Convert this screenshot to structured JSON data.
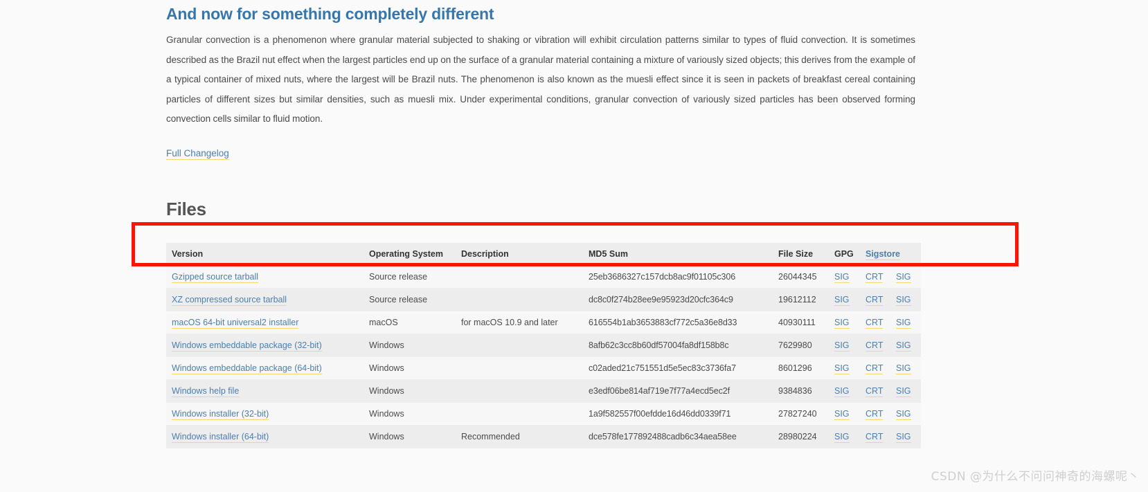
{
  "release": {
    "title": "And now for something completely different",
    "body": "Granular convection is a phenomenon where granular material subjected to shaking or vibration will exhibit circulation patterns similar to types of fluid convection. It is sometimes described as the Brazil nut effect when the largest particles end up on the surface of a granular material containing a mixture of variously sized objects; this derives from the example of a typical container of mixed nuts, where the largest will be Brazil nuts. The phenomenon is also known as the muesli effect since it is seen in packets of breakfast cereal containing particles of different sizes but similar densities, such as muesli mix. Under experimental conditions, granular convection of variously sized particles has been observed forming convection cells similar to fluid motion.",
    "changelog_label": "Full Changelog"
  },
  "files_section": {
    "heading": "Files",
    "columns": {
      "version": "Version",
      "os": "Operating System",
      "description": "Description",
      "md5": "MD5 Sum",
      "size": "File Size",
      "gpg": "GPG",
      "sigstore": "Sigstore"
    },
    "rows": [
      {
        "version": "Gzipped source tarball",
        "os": "Source release",
        "description": "",
        "md5": "25eb3686327c157dcb8ac9f01105c306",
        "size": "26044345",
        "gpg": "SIG",
        "sigstore_crt": "CRT",
        "sigstore_sig": "SIG"
      },
      {
        "version": "XZ compressed source tarball",
        "os": "Source release",
        "description": "",
        "md5": "dc8c0f274b28ee9e95923d20cfc364c9",
        "size": "19612112",
        "gpg": "SIG",
        "sigstore_crt": "CRT",
        "sigstore_sig": "SIG"
      },
      {
        "version": "macOS 64-bit universal2 installer",
        "os": "macOS",
        "description": "for macOS 10.9 and later",
        "md5": "616554b1ab3653883cf772c5a36e8d33",
        "size": "40930111",
        "gpg": "SIG",
        "sigstore_crt": "CRT",
        "sigstore_sig": "SIG"
      },
      {
        "version": "Windows embeddable package (32-bit)",
        "os": "Windows",
        "description": "",
        "md5": "8afb62c3cc8b60df57004fa8df158b8c",
        "size": "7629980",
        "gpg": "SIG",
        "sigstore_crt": "CRT",
        "sigstore_sig": "SIG"
      },
      {
        "version": "Windows embeddable package (64-bit)",
        "os": "Windows",
        "description": "",
        "md5": "c02aded21c751551d5e5ec83c3736fa7",
        "size": "8601296",
        "gpg": "SIG",
        "sigstore_crt": "CRT",
        "sigstore_sig": "SIG"
      },
      {
        "version": "Windows help file",
        "os": "Windows",
        "description": "",
        "md5": "e3edf06be814af719e7f77a4ecd5ec2f",
        "size": "9384836",
        "gpg": "SIG",
        "sigstore_crt": "CRT",
        "sigstore_sig": "SIG"
      },
      {
        "version": "Windows installer (32-bit)",
        "os": "Windows",
        "description": "",
        "md5": "1a9f582557f00efdde16d46dd0339f71",
        "size": "27827240",
        "gpg": "SIG",
        "sigstore_crt": "CRT",
        "sigstore_sig": "SIG"
      },
      {
        "version": "Windows installer (64-bit)",
        "os": "Windows",
        "description": "Recommended",
        "md5": "dce578fe177892488cadb6c34aea58ee",
        "size": "28980224",
        "gpg": "SIG",
        "sigstore_crt": "CRT",
        "sigstore_sig": "SIG"
      }
    ]
  },
  "annotation": {
    "highlight_color": "#f91600"
  },
  "watermark": {
    "text": "CSDN @为什么不问问神奇的海螺呢丶"
  }
}
